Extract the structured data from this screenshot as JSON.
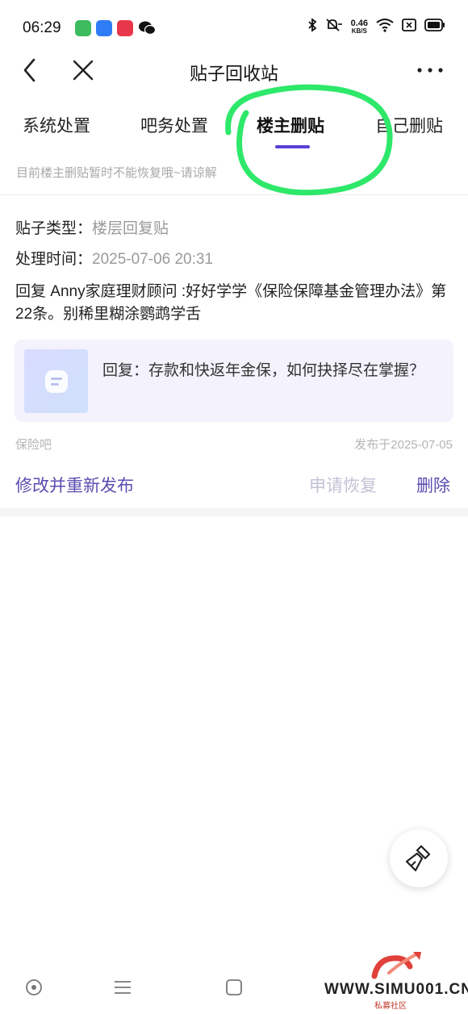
{
  "status_bar": {
    "time": "06:29",
    "net_speed_value": "0.46",
    "net_speed_unit": "KB/S"
  },
  "navbar": {
    "title": "贴子回收站"
  },
  "tabs": [
    {
      "label": "系统处置",
      "active": false
    },
    {
      "label": "吧务处置",
      "active": false
    },
    {
      "label": "楼主删贴",
      "active": true
    },
    {
      "label": "自己删贴",
      "active": false
    }
  ],
  "notice": "目前楼主删贴暂时不能恢复哦~请谅解",
  "post": {
    "type_key": "贴子类型：",
    "type_value": "楼层回复贴",
    "time_key": "处理时间：",
    "time_value": "2025-07-06 20:31",
    "content": "回复 Anny家庭理财顾问 :好好学学《保险保障基金管理办法》第22条。别稀里糊涂鹦鹉学舌",
    "quote": "回复：存款和快返年金保，如何抉择尽在掌握？",
    "bar_name": "保险吧",
    "published": "发布于2025-07-05"
  },
  "actions": {
    "edit": "修改并重新发布",
    "restore": "申请恢复",
    "delete": "删除"
  },
  "watermark": {
    "text": "WWW.SIMU001.CN",
    "sub": "私募社区"
  },
  "colors": {
    "accent": "#5a3fd6",
    "link": "#5a4db0",
    "disabled": "#c2c2d6",
    "annotation": "#2ee86a"
  }
}
